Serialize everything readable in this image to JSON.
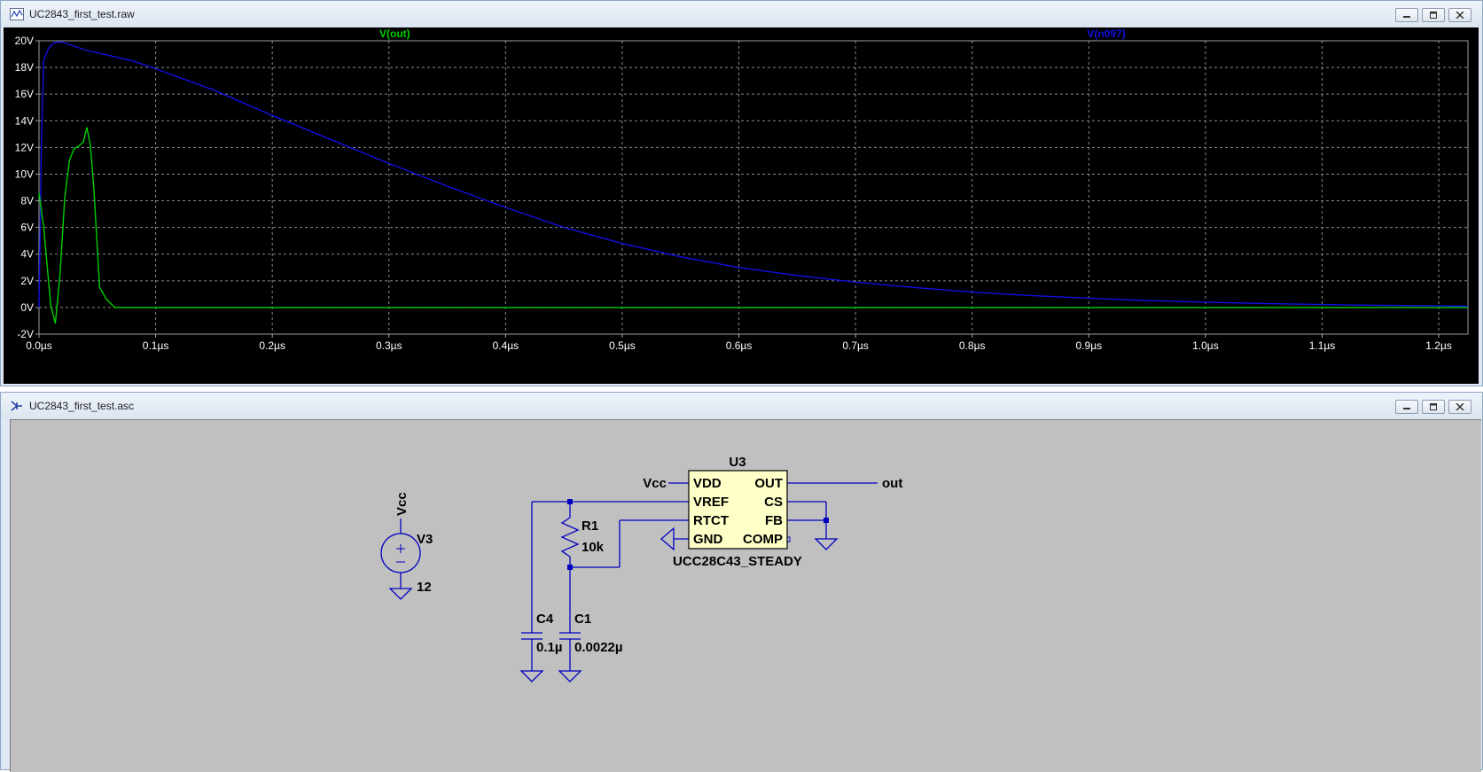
{
  "plot_window": {
    "title": "UC2843_first_test.raw",
    "icon": "waveform-window-icon"
  },
  "schematic_window": {
    "title": "UC2843_first_test.asc",
    "icon": "schematic-window-icon"
  },
  "window_controls": {
    "minimize": "minimize-icon",
    "maximize": "maximize-icon",
    "close": "close-icon"
  },
  "colors": {
    "plot_bg": "#000000",
    "grid": "#8a8a8a",
    "axis_text": "#ffffff",
    "trace_out": "#00d000",
    "trace_n097": "#1010e0",
    "schematic_bg": "#c0c0c0",
    "wire": "#0000c0",
    "ic_fill": "#ffffc8"
  },
  "chart_data": {
    "type": "line",
    "xlim": [
      0,
      1.225
    ],
    "ylim": [
      -2,
      20
    ],
    "x_unit": "µs",
    "x_ticks": [
      "0.0µs",
      "0.1µs",
      "0.2µs",
      "0.3µs",
      "0.4µs",
      "0.5µs",
      "0.6µs",
      "0.7µs",
      "0.8µs",
      "0.9µs",
      "1.0µs",
      "1.1µs",
      "1.2µs"
    ],
    "x_tick_values": [
      0,
      0.1,
      0.2,
      0.3,
      0.4,
      0.5,
      0.6,
      0.7,
      0.8,
      0.9,
      1.0,
      1.1,
      1.2
    ],
    "y_ticks": [
      "20V",
      "18V",
      "16V",
      "14V",
      "12V",
      "10V",
      "8V",
      "6V",
      "4V",
      "2V",
      "0V",
      "-2V"
    ],
    "y_tick_values": [
      20,
      18,
      16,
      14,
      12,
      10,
      8,
      6,
      4,
      2,
      0,
      -2
    ],
    "grid": true,
    "series": [
      {
        "name": "V(out)",
        "color": "#00d000",
        "x": [
          0,
          0.004,
          0.01,
          0.014,
          0.018,
          0.022,
          0.026,
          0.03,
          0.034,
          0.038,
          0.041,
          0.044,
          0.047,
          0.052,
          0.058,
          0.065,
          0.08,
          0.2,
          0.4,
          0.6,
          0.8,
          1.0,
          1.225
        ],
        "y": [
          8.6,
          6.0,
          0.2,
          -1.2,
          2.5,
          8.2,
          11.0,
          11.9,
          12.1,
          12.4,
          13.5,
          12.2,
          9.0,
          1.5,
          0.6,
          0,
          0,
          0,
          0,
          0,
          0,
          0,
          0
        ]
      },
      {
        "name": "V(n097)",
        "color": "#1010e0",
        "x": [
          0,
          0.002,
          0.004,
          0.008,
          0.012,
          0.016,
          0.02,
          0.03,
          0.04,
          0.06,
          0.08,
          0.1,
          0.15,
          0.2,
          0.25,
          0.3,
          0.35,
          0.4,
          0.45,
          0.5,
          0.55,
          0.6,
          0.65,
          0.7,
          0.75,
          0.8,
          0.85,
          0.9,
          0.95,
          1.0,
          1.05,
          1.1,
          1.15,
          1.2,
          1.225
        ],
        "y": [
          0,
          12,
          18.5,
          19.4,
          19.8,
          19.9,
          19.9,
          19.6,
          19.3,
          18.9,
          18.5,
          17.9,
          16.3,
          14.4,
          12.6,
          10.8,
          9.1,
          7.5,
          6.0,
          4.8,
          3.8,
          3.0,
          2.4,
          1.9,
          1.5,
          1.15,
          0.9,
          0.7,
          0.52,
          0.4,
          0.3,
          0.22,
          0.16,
          0.12,
          0.1
        ]
      }
    ]
  },
  "schematic": {
    "v3": {
      "designator": "V3",
      "value": "12",
      "net": "Vcc"
    },
    "u3": {
      "designator": "U3",
      "part": "UCC28C43_STEADY",
      "pins_left": [
        "VDD",
        "VREF",
        "RTCT",
        "GND"
      ],
      "pins_right": [
        "OUT",
        "CS",
        "FB",
        "COMP"
      ]
    },
    "r1": {
      "designator": "R1",
      "value": "10k"
    },
    "c4": {
      "designator": "C4",
      "value": "0.1µ"
    },
    "c1": {
      "designator": "C1",
      "value": "0.0022µ"
    },
    "labels": {
      "vcc": "Vcc",
      "out": "out"
    }
  }
}
